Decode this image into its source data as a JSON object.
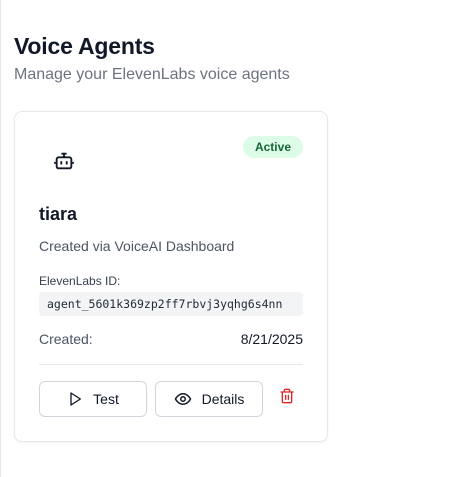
{
  "header": {
    "title": "Voice Agents",
    "subtitle": "Manage your ElevenLabs voice agents"
  },
  "agents": [
    {
      "icon": "bot-icon",
      "status": "Active",
      "status_color": "#166534",
      "status_bg": "#dcfce7",
      "name": "tiara",
      "description": "Created via VoiceAI Dashboard",
      "id_label": "ElevenLabs ID:",
      "id_value": "agent_5601k369zp2ff7rbvj3yqhg6s4nn",
      "created_label": "Created:",
      "created_value": "8/21/2025",
      "actions": {
        "test_label": "Test",
        "test_icon": "play-icon",
        "details_label": "Details",
        "details_icon": "eye-icon",
        "delete_icon": "trash-icon",
        "delete_color": "#dc2626"
      }
    }
  ]
}
